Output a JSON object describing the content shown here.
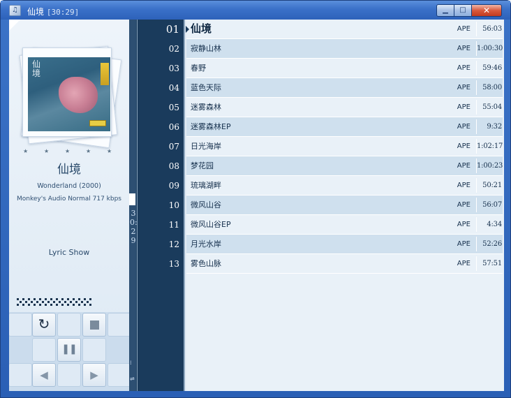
{
  "window": {
    "title": "仙境",
    "title_time": "[30:29]",
    "icon": "music-player-icon",
    "controls": {
      "minimize_icon": "minimize-icon",
      "maximize_icon": "maximize-icon",
      "close_icon": "close-icon"
    }
  },
  "now_playing": {
    "rating_stars": 5,
    "album_title": "仙境",
    "album_subtitle": "Wonderland (2000)",
    "format_info": "Monkey's Audio  Normal  717 kbps",
    "lyric_label": "Lyric Show",
    "vertical_time": "30:29",
    "cover_title": "仙境"
  },
  "transport": {
    "repeat_icon": "repeat-icon",
    "stop_icon": "stop-icon",
    "pause_icon": "pause-icon",
    "prev_icon": "previous-icon",
    "next_icon": "next-icon"
  },
  "playlist": {
    "current_index": 0,
    "tracks": [
      {
        "no": "01",
        "title": "仙境",
        "format": "APE",
        "length": "56:03"
      },
      {
        "no": "02",
        "title": "寂静山林",
        "format": "APE",
        "length": "1:00:30"
      },
      {
        "no": "03",
        "title": "春野",
        "format": "APE",
        "length": "59:46"
      },
      {
        "no": "04",
        "title": "蓝色天际",
        "format": "APE",
        "length": "58:00"
      },
      {
        "no": "05",
        "title": "迷雾森林",
        "format": "APE",
        "length": "55:04"
      },
      {
        "no": "06",
        "title": "迷雾森林EP",
        "format": "APE",
        "length": "9:32"
      },
      {
        "no": "07",
        "title": "日光海岸",
        "format": "APE",
        "length": "1:02:17"
      },
      {
        "no": "08",
        "title": "梦花园",
        "format": "APE",
        "length": "1:00:23"
      },
      {
        "no": "09",
        "title": "琉璃湖畔",
        "format": "APE",
        "length": "50:21"
      },
      {
        "no": "10",
        "title": "微风山谷",
        "format": "APE",
        "length": "56:07"
      },
      {
        "no": "11",
        "title": "微风山谷EP",
        "format": "APE",
        "length": "4:34"
      },
      {
        "no": "12",
        "title": "月光水岸",
        "format": "APE",
        "length": "52:26"
      },
      {
        "no": "13",
        "title": "雾色山脉",
        "format": "APE",
        "length": "57:51"
      }
    ]
  },
  "colors": {
    "frame": "#2a5fb5",
    "divider": "#1a3b5c",
    "row_even": "#cfe0ee",
    "row_odd": "#e9f1f8",
    "text": "#16304d"
  }
}
